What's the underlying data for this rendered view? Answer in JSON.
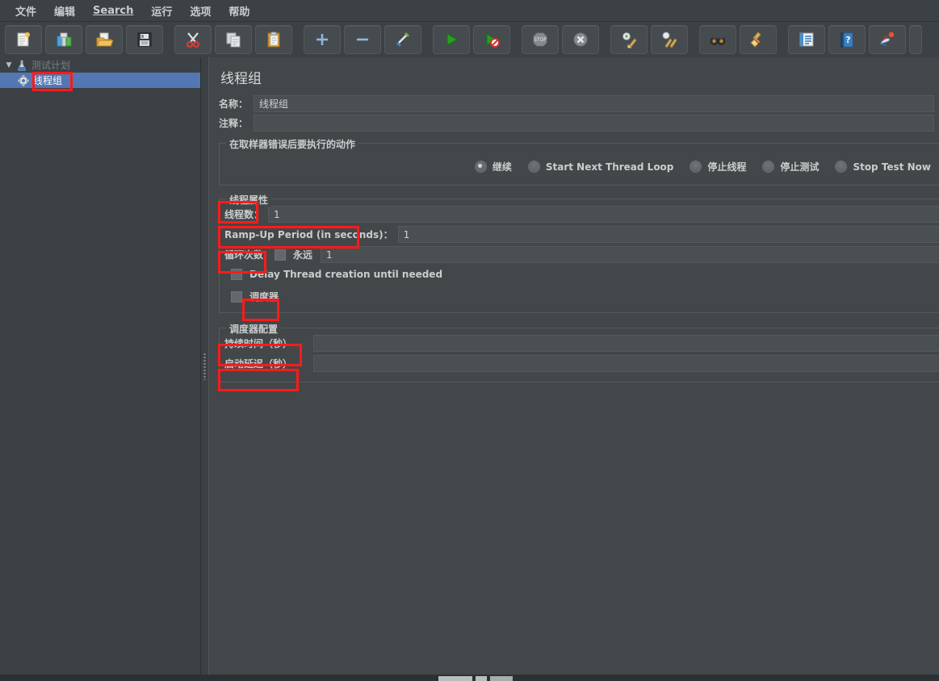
{
  "menubar": {
    "items": [
      {
        "label": "文件",
        "name": "menu-file"
      },
      {
        "label": "编辑",
        "name": "menu-edit"
      },
      {
        "label": "Search",
        "name": "menu-search"
      },
      {
        "label": "运行",
        "name": "menu-run"
      },
      {
        "label": "选项",
        "name": "menu-options"
      },
      {
        "label": "帮助",
        "name": "menu-help"
      }
    ]
  },
  "toolbar": {
    "buttons": [
      {
        "icon": "new-document-icon",
        "name": "toolbar-new"
      },
      {
        "icon": "templates-icon",
        "name": "toolbar-templates"
      },
      {
        "icon": "open-folder-icon",
        "name": "toolbar-open"
      },
      {
        "icon": "save-floppy-icon",
        "name": "toolbar-save"
      },
      {
        "icon": "cut-scissors-icon",
        "name": "toolbar-cut"
      },
      {
        "icon": "copy-icon",
        "name": "toolbar-copy"
      },
      {
        "icon": "paste-clipboard-icon",
        "name": "toolbar-paste"
      },
      {
        "icon": "plus-icon",
        "name": "toolbar-expand"
      },
      {
        "icon": "minus-icon",
        "name": "toolbar-collapse"
      },
      {
        "icon": "toggle-icon",
        "name": "toolbar-toggle"
      },
      {
        "icon": "play-green-icon",
        "name": "toolbar-start"
      },
      {
        "icon": "play-no-timers-icon",
        "name": "toolbar-start-no-pauses"
      },
      {
        "icon": "stop-octagon-icon",
        "name": "toolbar-stop"
      },
      {
        "icon": "shutdown-x-icon",
        "name": "toolbar-shutdown"
      },
      {
        "icon": "clear-gear-broom-icon",
        "name": "toolbar-clear"
      },
      {
        "icon": "clear-all-broom-icon",
        "name": "toolbar-clear-all"
      },
      {
        "icon": "binoculars-search-icon",
        "name": "toolbar-search"
      },
      {
        "icon": "reset-search-broom-icon",
        "name": "toolbar-reset-search"
      },
      {
        "icon": "function-helper-notebook-icon",
        "name": "toolbar-function-helper"
      },
      {
        "icon": "help-book-icon",
        "name": "toolbar-help"
      },
      {
        "icon": "about-rabbit-icon",
        "name": "toolbar-about"
      }
    ]
  },
  "tree": {
    "nodes": [
      {
        "label": "测试计划",
        "icon": "test-plan-flask-icon",
        "name": "tree-node-test-plan",
        "selected": false,
        "expanded": true
      },
      {
        "label": "线程组",
        "icon": "thread-group-gear-icon",
        "name": "tree-node-thread-group",
        "selected": true,
        "expanded": false
      }
    ]
  },
  "panel": {
    "title": "线程组",
    "name_label": "名称：",
    "name_value": "线程组",
    "comment_label": "注释：",
    "comment_value": "",
    "error_action": {
      "title": "在取样器错误后要执行的动作",
      "options": [
        {
          "label": "继续",
          "selected": true
        },
        {
          "label": "Start Next Thread Loop",
          "selected": false
        },
        {
          "label": "停止线程",
          "selected": false
        },
        {
          "label": "停止测试",
          "selected": false
        },
        {
          "label": "Stop Test Now",
          "selected": false
        }
      ]
    },
    "thread_properties": {
      "title": "线程属性",
      "num_threads_label": "线程数：",
      "num_threads_value": "1",
      "ramp_up_label": "Ramp-Up Period (in seconds)：",
      "ramp_up_value": "1",
      "loop_count_label": "循环次数",
      "forever_label": "永远",
      "forever_checked": false,
      "loop_count_value": "1",
      "delay_creation_label": "Delay Thread creation until needed",
      "delay_creation_checked": false,
      "scheduler_label": "调度器",
      "scheduler_checked": false
    },
    "scheduler_config": {
      "title": "调度器配置",
      "duration_label": "持续时间（秒）",
      "duration_value": "",
      "startup_delay_label": "启动延迟（秒）",
      "startup_delay_value": ""
    }
  },
  "colors": {
    "background": "#3c4145",
    "panel": "#434749",
    "field": "#4a4f52",
    "selection": "#5277b3",
    "text": "#c9cdce",
    "annotation": "#ff1b1b"
  }
}
